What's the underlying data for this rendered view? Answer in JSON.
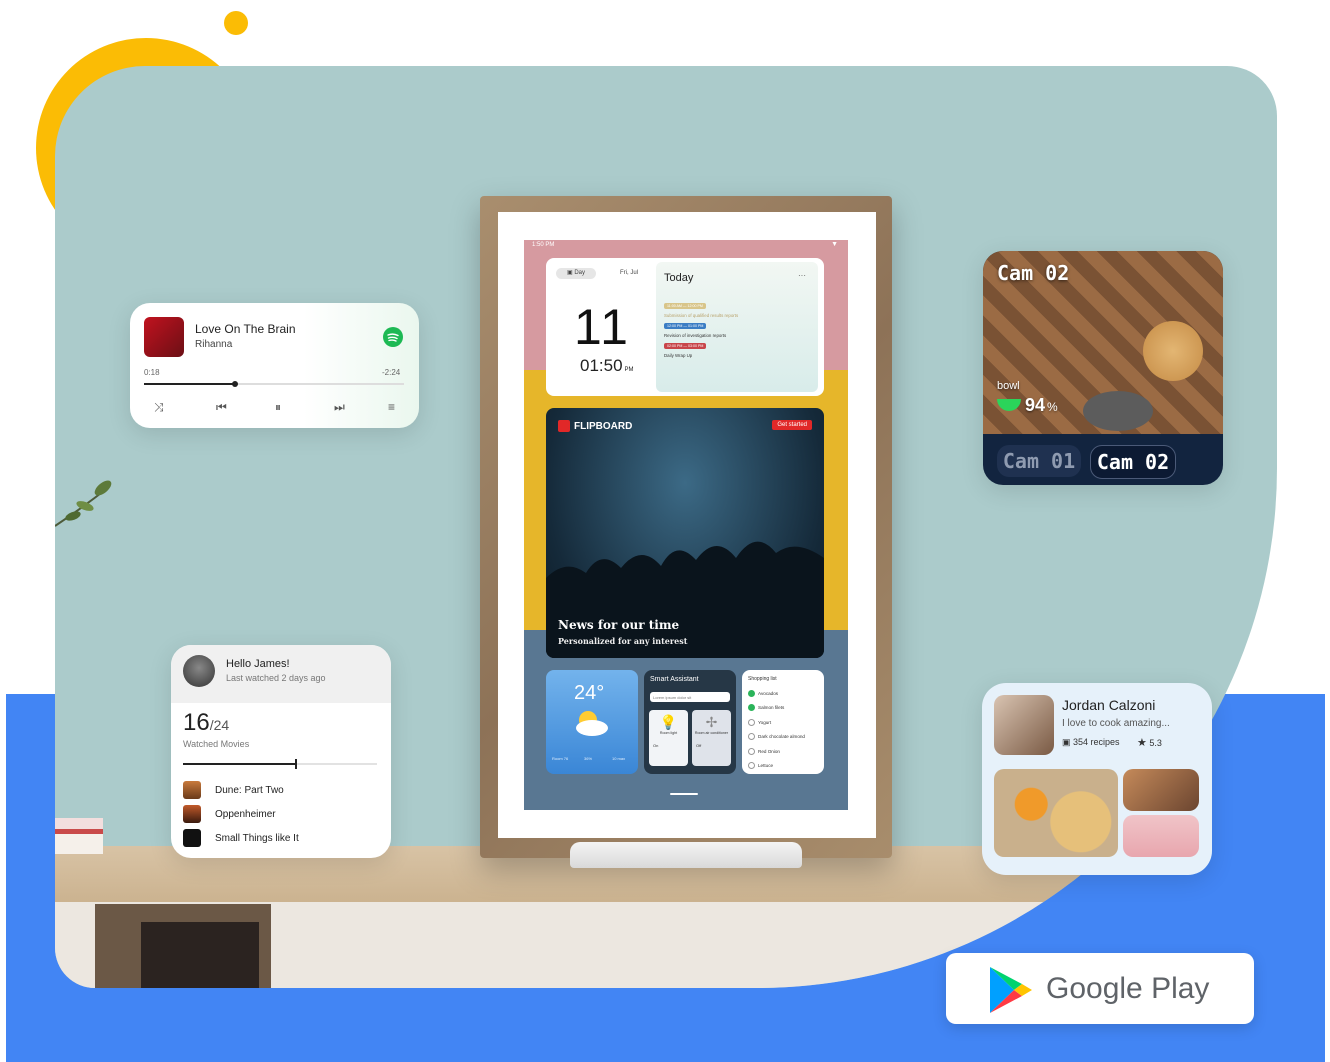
{
  "colors": {
    "teal_bg": "#abcbcb",
    "blue_bg": "#4285f4",
    "yellow": "#fbbc05",
    "spotify": "#1db954"
  },
  "music": {
    "title": "Love On The Brain",
    "artist": "Rihanna",
    "elapsed": "0:18",
    "remaining": "-2:24",
    "progress": 0.35,
    "controls": [
      "shuffle-icon",
      "previous-icon",
      "pause-icon",
      "next-icon",
      "queue-icon"
    ]
  },
  "tablet": {
    "status_time": "1:50 PM",
    "calendar": {
      "mode": "Day",
      "date": "Fri, Jul",
      "day": "11",
      "time": "01:50",
      "ampm": "PM",
      "today_label": "Today",
      "more": "···",
      "events": [
        {
          "time": "11:00 AM — 12:00 PM",
          "title": "Submission of qualified results reports"
        },
        {
          "time": "12:00 PM — 01:00 PM",
          "title": "Revision of investigation reports"
        },
        {
          "time": "02:00 PM — 03:00 PM",
          "title": "Daily Wrap Up"
        }
      ]
    },
    "news": {
      "brand": "FLIPBOARD",
      "cta": "Get started",
      "headline": "News for our time",
      "sub": "Personalized for any interest"
    },
    "weather": {
      "temp": "24°",
      "stats": [
        "Room 76",
        "36%",
        "10 max"
      ]
    },
    "assistant": {
      "title": "Smart Assistant",
      "input": "Lorem ipsum dolor sit",
      "device1": "Room light",
      "device1_state": "On",
      "device2": "Room air conditioner",
      "device2_state": "Off"
    },
    "shopping": {
      "title": "Shopping list",
      "items": [
        {
          "label": "Avocados",
          "done": true
        },
        {
          "label": "Salmon filets",
          "done": true
        },
        {
          "label": "Yogurt",
          "done": false
        },
        {
          "label": "Dark chocolate almond",
          "done": false
        },
        {
          "label": "Red Onion",
          "done": false
        },
        {
          "label": "Lettuce",
          "done": false
        }
      ]
    }
  },
  "camera": {
    "title": "Cam 02",
    "bowl_label": "bowl",
    "bowl_value": "94",
    "bowl_unit": "%",
    "tabs": [
      "Cam 01",
      "Cam 02"
    ],
    "active_tab": 1
  },
  "movies": {
    "greeting": "Hello James!",
    "last_watched": "Last watched 2 days ago",
    "count": "16",
    "total": "/24",
    "label": "Watched Movies",
    "progress": 0.58,
    "items": [
      "Dune: Part Two",
      "Oppenheimer",
      "Small Things like It"
    ]
  },
  "recipes": {
    "name": "Jordan Calzoni",
    "bio": "I love to cook amazing...",
    "recipe_count": "354 recipes",
    "rating": "5.3"
  },
  "store": {
    "label": "Google Play"
  }
}
